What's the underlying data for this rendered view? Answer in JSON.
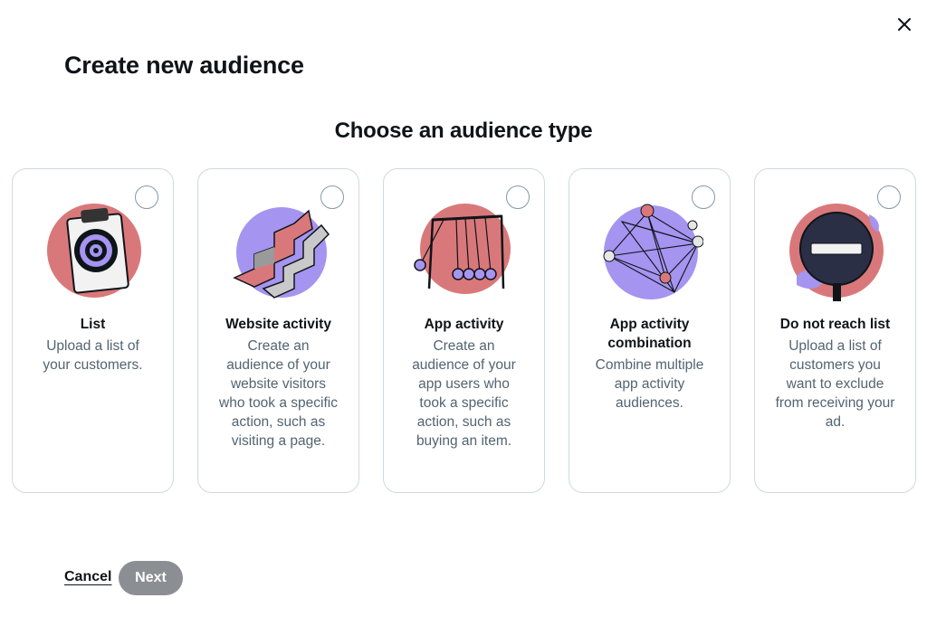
{
  "header": {
    "title": "Create new audience",
    "close_icon": "close-icon"
  },
  "main": {
    "section_title": "Choose an audience type",
    "cards": [
      {
        "title": "List",
        "description": "Upload a list of your customers.",
        "icon": "target-clipboard-icon",
        "selected": false
      },
      {
        "title": "Website activity",
        "description": "Create an audience of your website visitors who took a specific action, such as visiting a page.",
        "icon": "stairs-arrows-icon",
        "selected": false
      },
      {
        "title": "App activity",
        "description": "Create an audience of your app users who took a specific action, such as buying an item.",
        "icon": "newtons-cradle-icon",
        "selected": false
      },
      {
        "title": "App activity combination",
        "description": "Combine multiple app activity audiences.",
        "icon": "pinned-network-icon",
        "selected": false
      },
      {
        "title": "Do not reach list",
        "description": "Upload a list of customers you want to exclude from receiving your ad.",
        "icon": "no-entry-sign-icon",
        "selected": false
      }
    ]
  },
  "footer": {
    "cancel_label": "Cancel",
    "next_label": "Next",
    "next_disabled": true
  },
  "colors": {
    "accent_pink": "#d9787a",
    "accent_purple": "#a594f0",
    "border": "#cfd9de",
    "disabled_button": "#8b8f93",
    "secondary_text": "#536471"
  }
}
